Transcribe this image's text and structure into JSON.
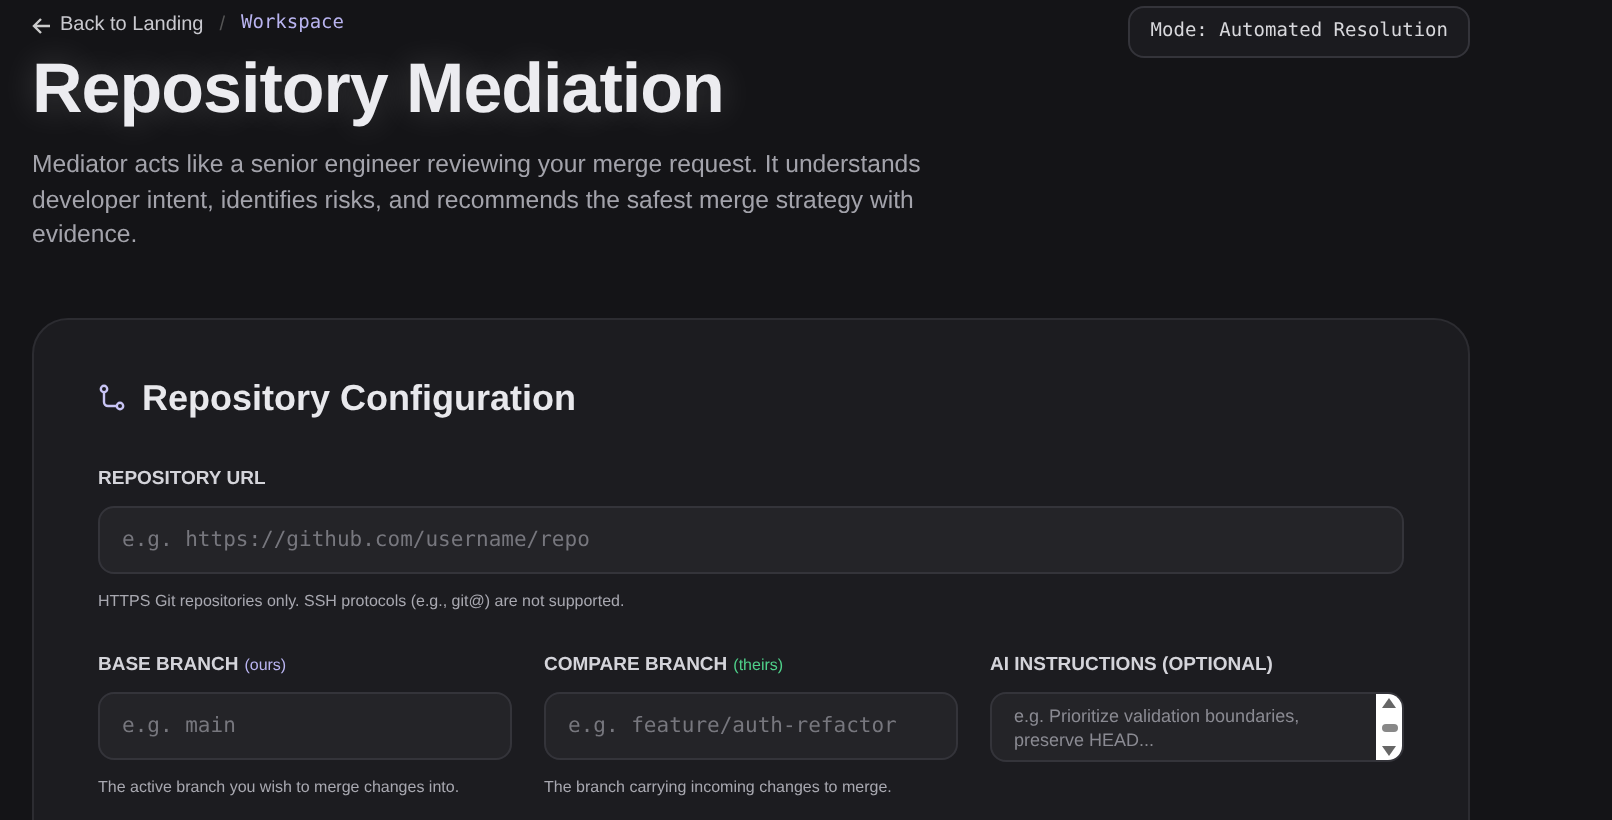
{
  "breadcrumb": {
    "back": "Back to Landing",
    "separator": "/",
    "current": "Workspace"
  },
  "mode_badge": "Mode: Automated Resolution",
  "title": "Repository Mediation",
  "description": "Mediator acts like a senior engineer reviewing your merge request. It understands developer intent, identifies risks, and recommends the safest merge strategy with evidence.",
  "config": {
    "heading": "Repository Configuration",
    "url_field": {
      "label": "REPOSITORY URL",
      "placeholder": "e.g. https://github.com/username/repo",
      "help": "HTTPS Git repositories only. SSH protocols (e.g., git@) are not supported."
    },
    "fields": [
      {
        "kind": "input",
        "label": "BASE BRANCH",
        "tag": "(ours)",
        "color": "#b9b4f0",
        "placeholder": "e.g. main",
        "help": "The active branch you wish to merge changes into."
      },
      {
        "kind": "input",
        "label": "COMPARE BRANCH",
        "tag": "(theirs)",
        "color": "#4fd08a",
        "placeholder": "e.g. feature/auth-refactor",
        "help": "The branch carrying incoming changes to merge."
      },
      {
        "kind": "textarea",
        "label": "AI INSTRUCTIONS (OPTIONAL)",
        "placeholder": "e.g. Prioritize validation boundaries, preserve HEAD..."
      }
    ]
  }
}
